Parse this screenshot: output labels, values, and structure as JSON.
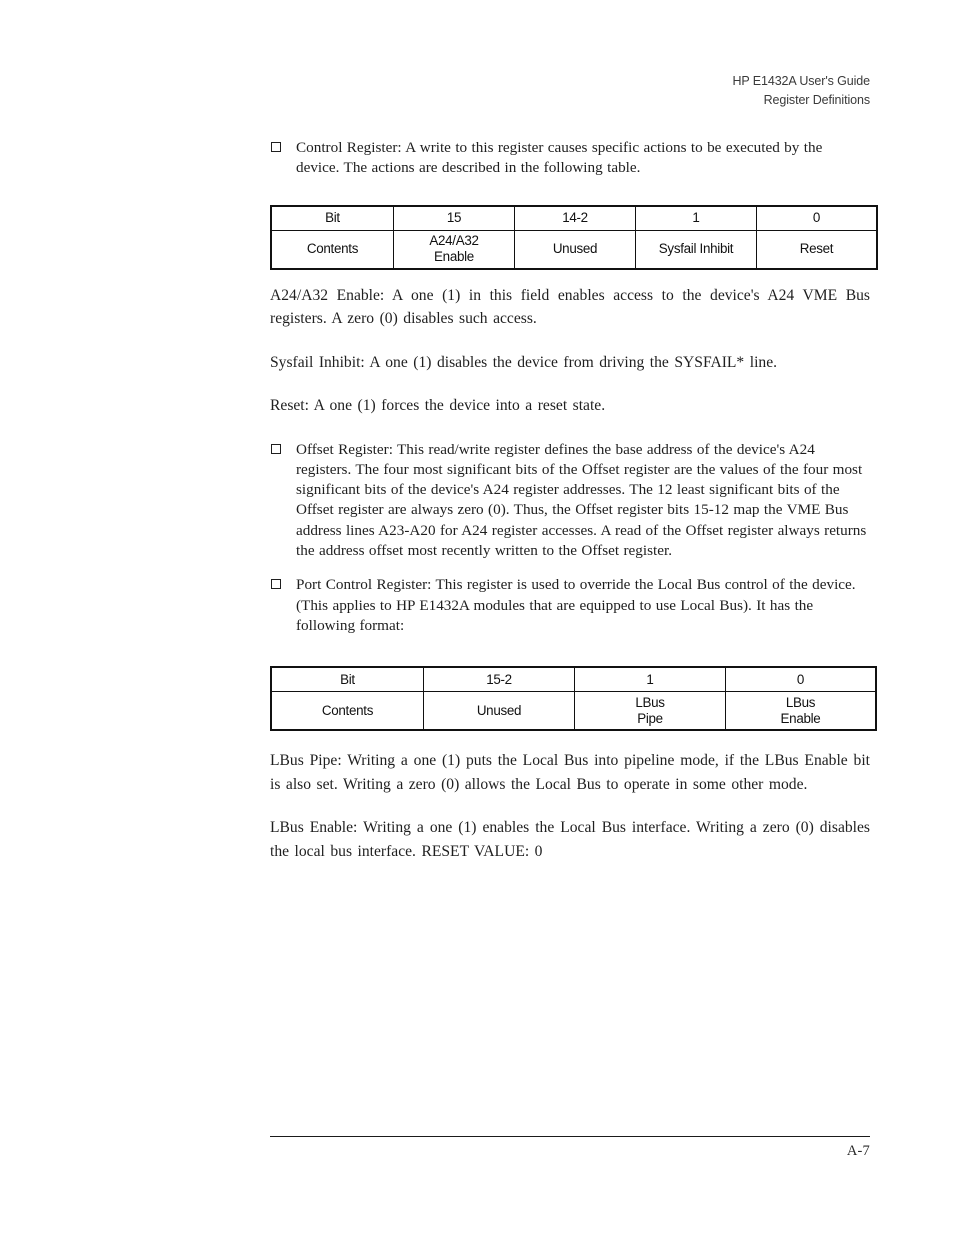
{
  "header": {
    "line1": "HP E1432A User's Guide",
    "line2": "Register Definitions"
  },
  "body": {
    "bullet_control_register": "Control Register: A write to this register causes specific actions to be executed by the device.  The actions are described in the following table.",
    "para_a24_a32_enable": "A24/A32 Enable:  A one (1) in this field enables access to the device's A24 VME Bus registers.  A zero (0) disables such access.",
    "para_sysfail_inhibit": "Sysfail Inhibit:  A one (1) disables the device from driving the SYSFAIL* line.",
    "para_reset": "Reset:  A one (1) forces the device into a reset state.",
    "bullet_offset_register": "Offset Register:  This read/write register defines the base address of the device's A24 registers.  The four most significant bits of the Offset register are the values of the four most significant bits of the device's A24 register addresses.  The 12 least significant bits of the Offset register are always zero (0).  Thus, the Offset register bits 15-12 map the VME Bus address lines A23-A20 for A24 register accesses.  A read of the Offset register always returns the address offset most recently written to the Offset register.",
    "bullet_port_control_register": "Port Control Register:  This register is used to override the Local Bus control of the device.  (This applies to HP E1432A modules that are equipped to use Local Bus).  It has the following format:",
    "para_lbus_pipe": "LBus Pipe:  Writing a one (1) puts the Local Bus into pipeline mode, if the LBus Enable bit is also set.  Writing a zero (0) allows the Local Bus to operate in some other mode.",
    "para_lbus_enable": "LBus Enable:  Writing a one (1) enables the Local Bus interface.  Writing a zero (0) disables the local bus interface.  RESET VALUE: 0"
  },
  "control_register_table": {
    "row_labels": [
      "Bit",
      "Contents"
    ],
    "bits": [
      "15",
      "14-2",
      "1",
      "0"
    ],
    "contents": [
      {
        "line1": "A24/A32",
        "line2": "Enable"
      },
      {
        "line1": "Unused",
        "line2": ""
      },
      {
        "line1": "Sysfail Inhibit",
        "line2": ""
      },
      {
        "line1": "Reset",
        "line2": ""
      }
    ]
  },
  "port_control_register_table": {
    "row_labels": [
      "Bit",
      "Contents"
    ],
    "bits": [
      "15-2",
      "1",
      "0"
    ],
    "contents": [
      {
        "line1": "Unused",
        "line2": ""
      },
      {
        "line1": "LBus",
        "line2": "Pipe"
      },
      {
        "line1": "LBus",
        "line2": "Enable"
      }
    ]
  },
  "footer": {
    "page_number": "A-7"
  }
}
